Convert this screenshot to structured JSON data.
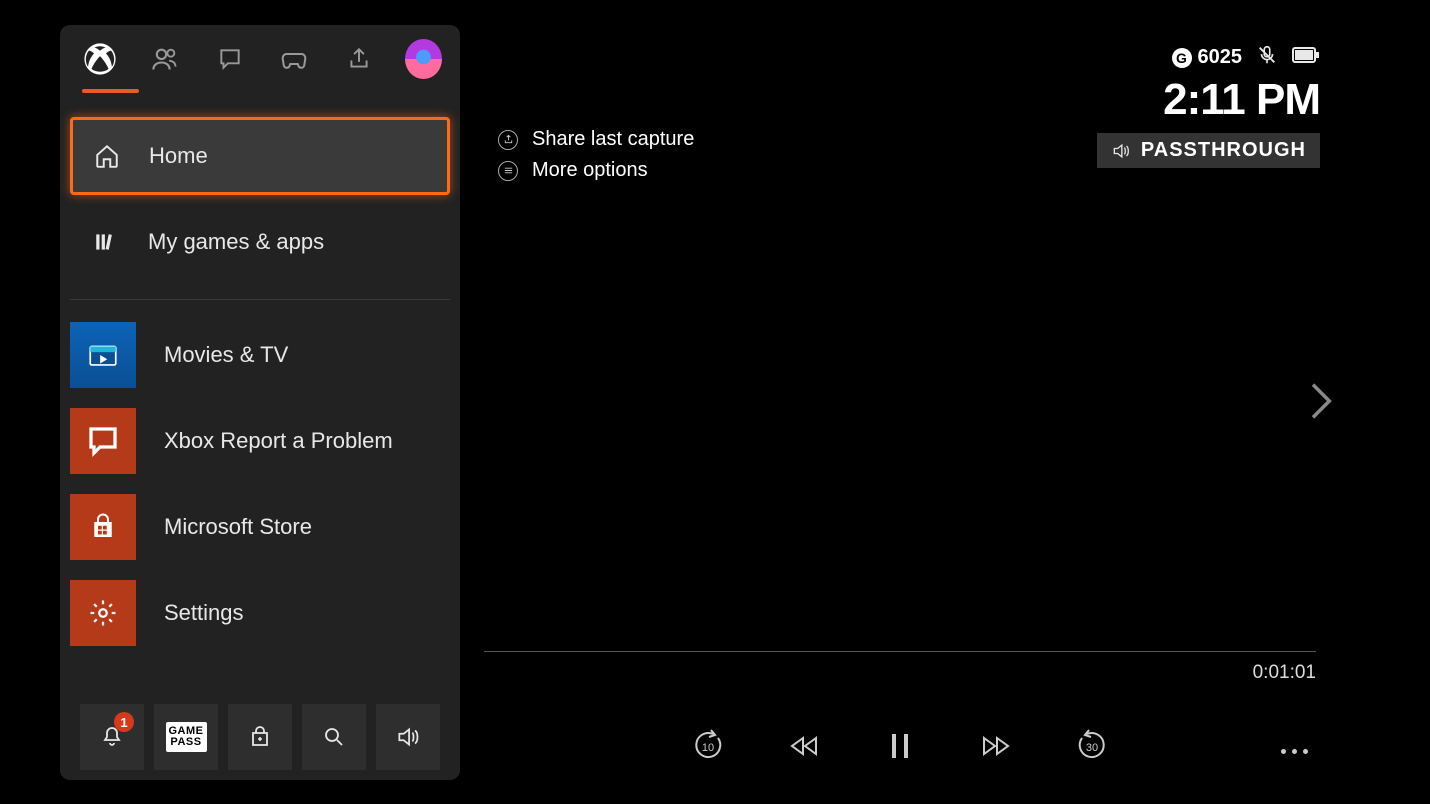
{
  "guide": {
    "tabs": [
      "profile",
      "people",
      "chat",
      "gaming",
      "share"
    ],
    "menu": {
      "home": "Home",
      "mygames": "My games & apps"
    },
    "apps": {
      "movies": "Movies & TV",
      "report": "Xbox Report a Problem",
      "store": "Microsoft Store",
      "settings": "Settings"
    },
    "footer": {
      "notif_badge": "1",
      "gamepass": "GAME\nPASS"
    }
  },
  "side": {
    "share": "Share last capture",
    "more": "More options"
  },
  "status": {
    "gamerscore": "6025",
    "clock": "2:11 PM",
    "audio_mode": "PASSTHROUGH"
  },
  "media": {
    "duration": "0:01:01",
    "skip_back_label": "10",
    "skip_fwd_label": "30"
  }
}
